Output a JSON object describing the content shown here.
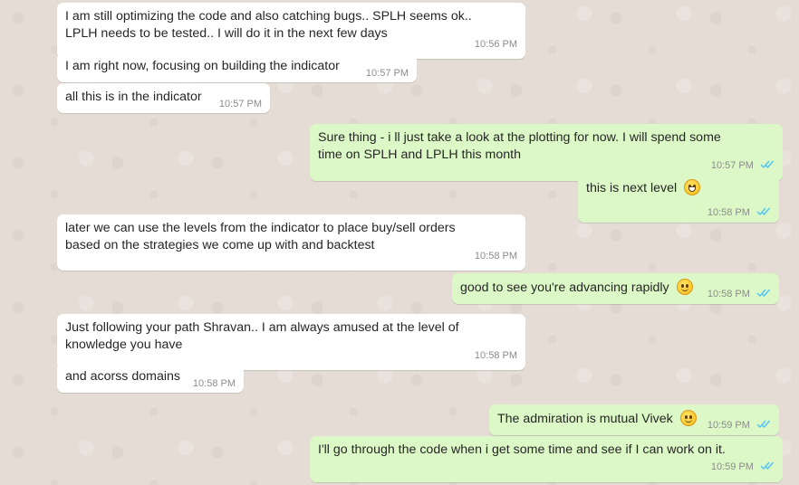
{
  "messages": [
    {
      "dir": "in",
      "text": "I am still optimizing the code and also catching bugs.. SPLH seems ok..\nLPLH needs to be tested.. I will do it in the next few days",
      "time": "10:56 PM"
    },
    {
      "dir": "in",
      "text": "I am right now, focusing on building the indicator",
      "time": "10:57 PM"
    },
    {
      "dir": "in",
      "text": "all this is in the indicator",
      "time": "10:57 PM"
    },
    {
      "dir": "out",
      "text": "Sure thing - i ll just take a look at the plotting for now. I will spend some\ntime on SPLH and LPLH this month",
      "time": "10:57 PM"
    },
    {
      "dir": "out",
      "text": "this is next level",
      "emoji": "grinning-face",
      "time": "10:58 PM"
    },
    {
      "dir": "in",
      "text": "later we can use the levels from the indicator to place buy/sell orders\nbased on the strategies we come up with and backtest",
      "time": "10:58 PM"
    },
    {
      "dir": "out",
      "text": "good to see you're advancing rapidly",
      "emoji": "smiling-face",
      "time": "10:58 PM"
    },
    {
      "dir": "in",
      "text": "Just following your path Shravan.. I am always amused at the level of\nknowledge you have",
      "time": "10:58 PM"
    },
    {
      "dir": "in",
      "text": "and acorss domains",
      "time": "10:58 PM"
    },
    {
      "dir": "out",
      "text": "The admiration is mutual Vivek",
      "emoji": "smiling-face",
      "time": "10:59 PM"
    },
    {
      "dir": "out",
      "text": "I'll go through the code when i get some time and see if I can work on it.",
      "time": "10:59 PM"
    }
  ],
  "colors": {
    "background": "#e5ddd5",
    "incoming_bubble": "#ffffff",
    "outgoing_bubble": "#dcf8c6",
    "read_ticks": "#4fc3f7",
    "timestamp": "#8c8c8c"
  },
  "icons": {
    "read_receipt": "double-check-icon",
    "grinning": "grinning-face-emoji",
    "smiling": "smiling-face-emoji"
  }
}
